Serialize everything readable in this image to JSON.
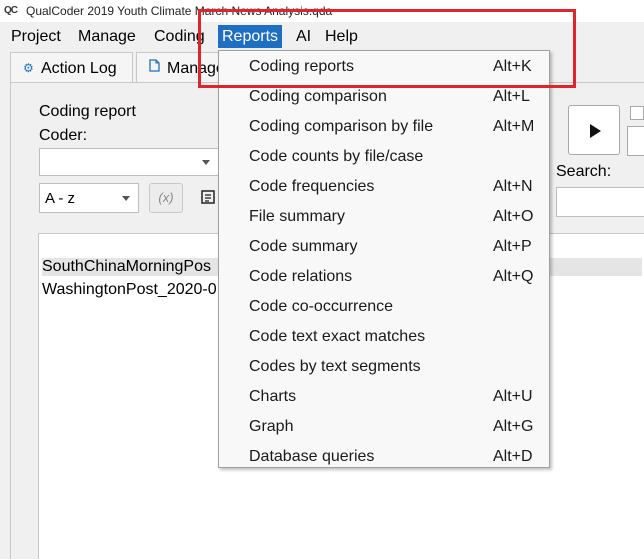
{
  "window": {
    "logo": "QC",
    "title": "QualCoder 2019 Youth Climate March News Analysis.qda"
  },
  "menubar": {
    "items": [
      {
        "label": "Project"
      },
      {
        "label": "Manage"
      },
      {
        "label": "Coding"
      },
      {
        "label": "Reports",
        "active": true
      },
      {
        "label": "AI"
      },
      {
        "label": "Help"
      }
    ]
  },
  "tabs": [
    {
      "label": "Action Log",
      "icon": "gear-icon"
    },
    {
      "label": "Manage",
      "icon": "document-icon"
    }
  ],
  "coding_report": {
    "heading": "Coding report",
    "coder_label": "Coder:",
    "coder_value": "",
    "sort_value": "A - z",
    "regex_button": "(x)",
    "search_label": "Search:",
    "search_value": ""
  },
  "file_list": [
    {
      "name": "SouthChinaMorningPos",
      "selected": true
    },
    {
      "name": "WashingtonPost_2020-0",
      "selected": false
    }
  ],
  "reports_menu": {
    "items": [
      {
        "label": "Coding reports",
        "shortcut": "Alt+K"
      },
      {
        "label": "Coding comparison",
        "shortcut": "Alt+L"
      },
      {
        "label": "Coding comparison by file",
        "shortcut": "Alt+M"
      },
      {
        "label": "Code counts by file/case",
        "shortcut": ""
      },
      {
        "label": "Code frequencies",
        "shortcut": "Alt+N"
      },
      {
        "label": "File summary",
        "shortcut": "Alt+O"
      },
      {
        "label": "Code summary",
        "shortcut": "Alt+P"
      },
      {
        "label": "Code relations",
        "shortcut": "Alt+Q"
      },
      {
        "label": "Code co-occurrence",
        "shortcut": ""
      },
      {
        "label": "Code text exact matches",
        "shortcut": ""
      },
      {
        "label": "Codes by text segments",
        "shortcut": ""
      },
      {
        "label": "Charts",
        "shortcut": "Alt+U"
      },
      {
        "label": "Graph",
        "shortcut": "Alt+G"
      },
      {
        "label": "Database queries",
        "shortcut": "Alt+D"
      }
    ]
  },
  "colors": {
    "menu_active": "#1e6fc4",
    "highlight_border": "#e0242b"
  }
}
